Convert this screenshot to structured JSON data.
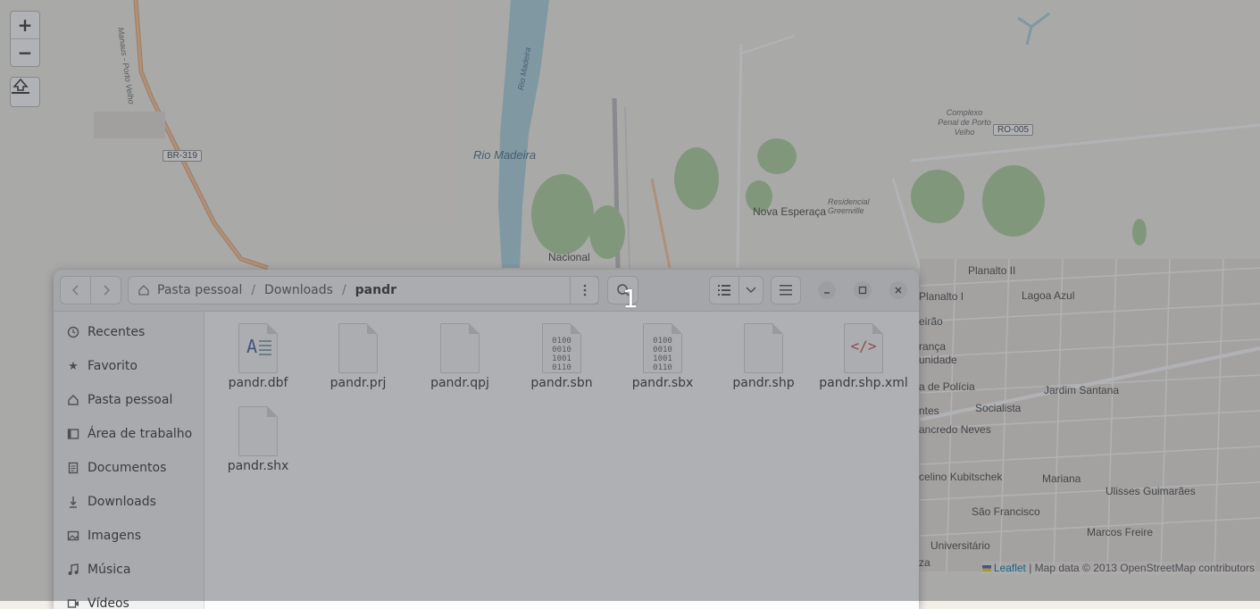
{
  "map": {
    "labels": {
      "rio_madeira": "Rio Madeira",
      "nova_esperanca": "Nova Esperaça",
      "residencial": "Residencial Greenville",
      "complexo": "Complexo Penal de Porto Velho",
      "nacional": "Nacional",
      "planalto2": "Planalto II",
      "planalto1": "Planalto I",
      "lagoa_azul": "Lagoa Azul",
      "jardim_santana": "Jardim Santana",
      "socialista": "Socialista",
      "tancredo": "ancredo Neves",
      "juscelino": "celino Kubitschek",
      "mariana": "Mariana",
      "ulisses": "Ulisses Guimarães",
      "sao_francisco": "São Francisco",
      "marcos_freire": "Marcos Freire",
      "universitario": "Universitário",
      "policia": "a de Polícia",
      "comunidade": "unidade",
      "eirao": "eirão",
      "ranca": "rança",
      "ntes": "ntes",
      "za": "za",
      "br319": "BR-319",
      "ro005": "RO-005",
      "rio_label_small": "Rio Madeira",
      "road_left": "Manaus - Porto Velho"
    },
    "controls": {
      "zoom_in": "+",
      "zoom_out": "−"
    },
    "attribution": {
      "leaflet": "Leaflet",
      "rest": " | Map data © 2013 OpenStreetMap contributors"
    }
  },
  "file_manager": {
    "path": {
      "home": "Pasta pessoal",
      "sep": "/",
      "downloads": "Downloads",
      "current": "pandr"
    },
    "sidebar": [
      {
        "label": "Recentes",
        "icon": "clock-icon"
      },
      {
        "label": "Favorito",
        "icon": "star-icon"
      },
      {
        "label": "Pasta pessoal",
        "icon": "home-icon"
      },
      {
        "label": "Área de trabalho",
        "icon": "desktop-icon"
      },
      {
        "label": "Documentos",
        "icon": "document-icon"
      },
      {
        "label": "Downloads",
        "icon": "download-icon"
      },
      {
        "label": "Imagens",
        "icon": "image-icon"
      },
      {
        "label": "Música",
        "icon": "music-icon"
      },
      {
        "label": "Vídeos",
        "icon": "video-icon"
      }
    ],
    "files": [
      {
        "name": "pandr.dbf",
        "type": "text"
      },
      {
        "name": "pandr.prj",
        "type": "blank"
      },
      {
        "name": "pandr.qpj",
        "type": "blank"
      },
      {
        "name": "pandr.sbn",
        "type": "binary"
      },
      {
        "name": "pandr.sbx",
        "type": "binary"
      },
      {
        "name": "pandr.shp",
        "type": "blank"
      },
      {
        "name": "pandr.shp.xml",
        "type": "xml"
      },
      {
        "name": "pandr.shx",
        "type": "blank"
      }
    ],
    "binary_glyph": "0100\n0010\n1001\n0110",
    "text_glyph": "A",
    "xml_glyph": "</>"
  },
  "overlay_badge": "1"
}
